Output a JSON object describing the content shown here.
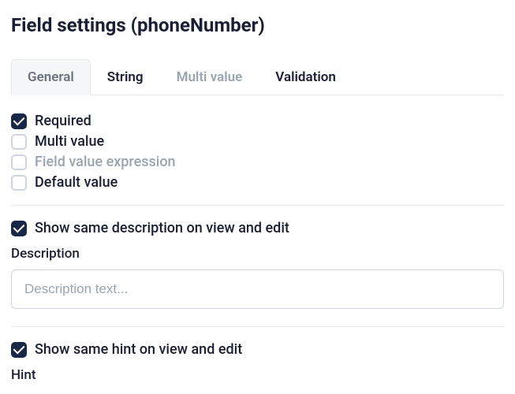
{
  "header": {
    "title": "Field settings (phoneNumber)"
  },
  "tabs": [
    {
      "label": "General",
      "active": true,
      "dark": false
    },
    {
      "label": "String",
      "active": false,
      "dark": true
    },
    {
      "label": "Multi value",
      "active": false,
      "dark": false
    },
    {
      "label": "Validation",
      "active": false,
      "dark": true
    }
  ],
  "options": {
    "required": {
      "label": "Required",
      "checked": true,
      "muted": false
    },
    "multiValue": {
      "label": "Multi value",
      "checked": false,
      "muted": false
    },
    "fieldExpression": {
      "label": "Field value expression",
      "checked": false,
      "muted": true
    },
    "defaultValue": {
      "label": "Default value",
      "checked": false,
      "muted": false
    }
  },
  "description": {
    "showSame": {
      "label": "Show same description on view and edit",
      "checked": true
    },
    "fieldLabel": "Description",
    "placeholder": "Description text...",
    "value": ""
  },
  "hint": {
    "showSame": {
      "label": "Show same hint on view and edit",
      "checked": true
    },
    "fieldLabel": "Hint"
  }
}
